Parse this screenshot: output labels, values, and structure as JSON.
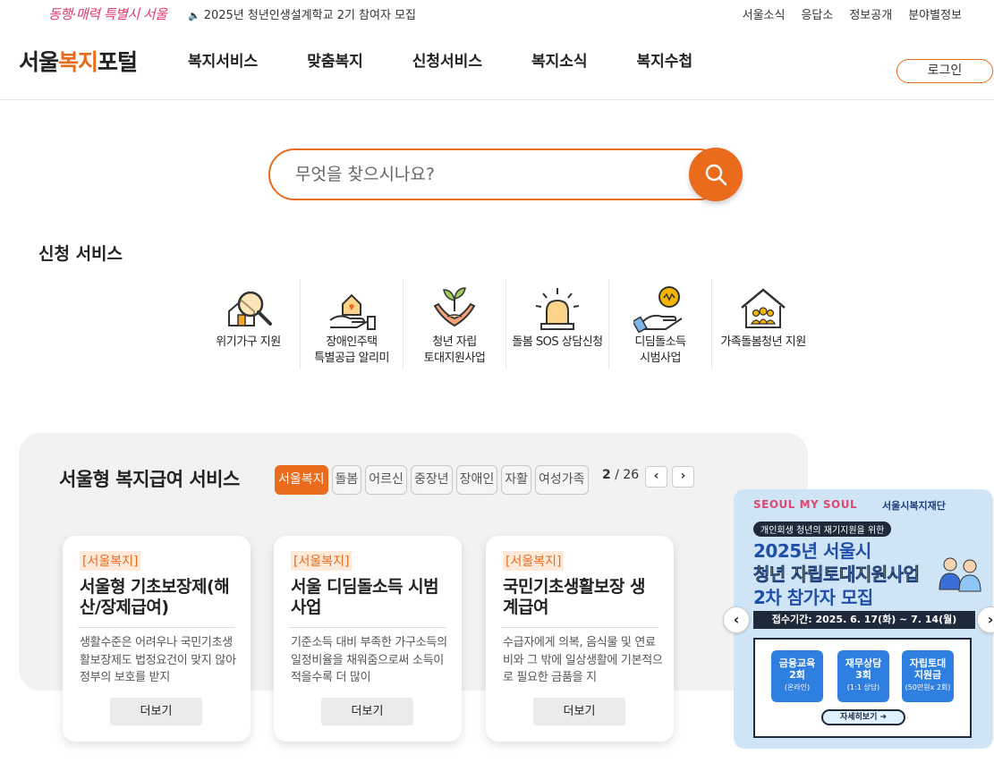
{
  "topbar": {
    "slogan": "동행·매력 특별시 서울",
    "notice": "2025년 청년인생설계학교 2기 참여자 모집",
    "utils": [
      "서울소식",
      "응답소",
      "정보공개",
      "분야별정보"
    ]
  },
  "header": {
    "logo_main": "서울",
    "logo_accent": "복지",
    "logo_tail": "포털",
    "menu": [
      "복지서비스",
      "맞춤복지",
      "신청서비스",
      "복지소식",
      "복지수첩"
    ],
    "login": "로그인"
  },
  "search": {
    "placeholder": "무엇을 찾으시나요?"
  },
  "services": {
    "title": "신청 서비스",
    "items": [
      {
        "label": "위기가구 지원",
        "icon": "magnifier-house-icon"
      },
      {
        "label": "장애인주택\n특별공급 알리미",
        "icon": "hand-house-icon"
      },
      {
        "label": "청년 자립\n토대지원사업",
        "icon": "hands-sprout-icon"
      },
      {
        "label": "돌봄 SOS 상담신청",
        "icon": "alarm-light-icon"
      },
      {
        "label": "디딤돌소득\n시범사업",
        "icon": "hand-coin-icon"
      },
      {
        "label": "가족돌봄청년 지원",
        "icon": "house-family-icon"
      }
    ]
  },
  "welfare": {
    "title": "서울형 복지급여 서비스",
    "chips": [
      "서울복지",
      "돌봄",
      "어르신",
      "중장년",
      "장애인",
      "자활",
      "여성가족"
    ],
    "active_chip": "서울복지",
    "page_current": "2",
    "page_total": "/ 26",
    "prev": "‹",
    "next": "›",
    "cards": [
      {
        "tag": "[서울복지]",
        "title": "서울형 기초보장제(해산/장제급여)",
        "desc": "생활수준은 어려우나 국민기초생활보장제도 법정요건이 맞지 않아 정부의 보호를 받지",
        "more": "더보기"
      },
      {
        "tag": "[서울복지]",
        "title": "서울 디딤돌소득 시범사업",
        "desc": "기준소득 대비 부족한 가구소득의 일정비율을 채워줌으로써 소득이 적을수록 더 많이",
        "more": "더보기"
      },
      {
        "tag": "[서울복지]",
        "title": "국민기초생활보장 생계급여",
        "desc": "수급자에게 의복, 음식물 및 연료비와 그 밖에 일상생활에 기본적으로 필요한 금품을 지",
        "more": "더보기"
      }
    ]
  },
  "banner": {
    "brand_left": "SEOUL MY SOUL",
    "brand_right": "서울시복지재단",
    "pill": "개인회생 청년의 재기지원을 위한",
    "line1": "2025년 서울시",
    "line2": "청년 자립토대지원사업",
    "line3": "2차 참가자 모집",
    "period": "접수기간: 2025. 6. 17(화) ~ 7. 14(월)",
    "boxes": [
      {
        "main": "금융교육\n2회",
        "sub": "(온라인)"
      },
      {
        "main": "재무상담\n3회",
        "sub": "(1:1 상담)"
      },
      {
        "main": "자립토대\n지원금",
        "sub": "(50만원x 2회)"
      }
    ],
    "detail": "자세히보기 ➜",
    "prev": "‹",
    "next": "›"
  },
  "colors": {
    "accent": "#ea6b1c",
    "banner_bg": "#cfe5f6",
    "banner_blue": "#1f4fa8"
  }
}
